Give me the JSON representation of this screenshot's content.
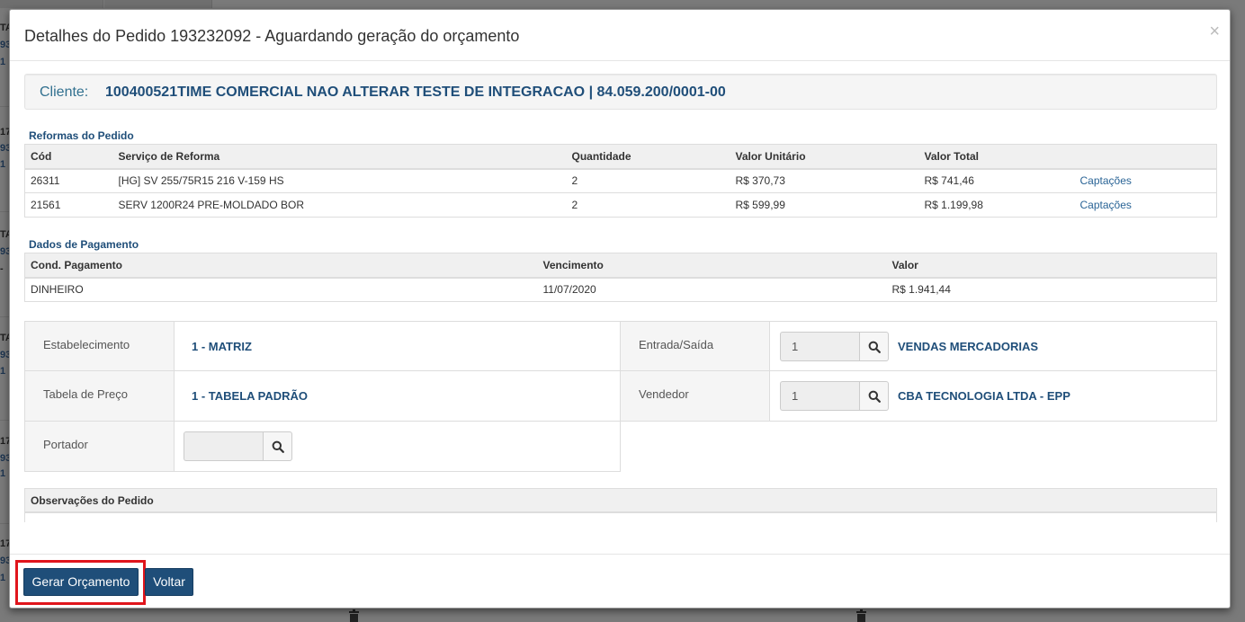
{
  "modal": {
    "title": "Detalhes do Pedido 193232092 - Aguardando geração do orçamento",
    "close_label": "×"
  },
  "client": {
    "label": "Cliente:",
    "value": "100400521TIME COMERCIAL NAO ALTERAR TESTE DE INTEGRACAO | 84.059.200/0001-00"
  },
  "reformas": {
    "title": "Reformas do Pedido",
    "headers": [
      "Cód",
      "Serviço de Reforma",
      "Quantidade",
      "Valor Unitário",
      "Valor Total",
      ""
    ],
    "rows": [
      {
        "cod": "26311",
        "servico": "[HG] SV 255/75R15 216 V-159 HS",
        "quantidade": "2",
        "unitario": "R$ 370,73",
        "total": "R$ 741,46",
        "acao": "Captações"
      },
      {
        "cod": "21561",
        "servico": "SERV 1200R24 PRE-MOLDADO BOR",
        "quantidade": "2",
        "unitario": "R$ 599,99",
        "total": "R$ 1.199,98",
        "acao": "Captações"
      }
    ]
  },
  "pagamento": {
    "title": "Dados de Pagamento",
    "headers": [
      "Cond. Pagamento",
      "Vencimento",
      "Valor"
    ],
    "rows": [
      {
        "cond": "DINHEIRO",
        "vencimento": "11/07/2020",
        "valor": "R$ 1.941,44"
      }
    ]
  },
  "form": {
    "estabelecimento_label": "Estabelecimento",
    "estabelecimento_value": "1 - MATRIZ",
    "tabela_label": "Tabela de Preço",
    "tabela_value": "1 - TABELA PADRÃO",
    "portador_label": "Portador",
    "portador_value": "",
    "entrada_label": "Entrada/Saída",
    "entrada_code": "1",
    "entrada_desc": "VENDAS MERCADORIAS",
    "vendedor_label": "Vendedor",
    "vendedor_code": "1",
    "vendedor_desc": "CBA TECNOLOGIA LTDA - EPP"
  },
  "observacoes": {
    "title": "Observações do Pedido"
  },
  "footer": {
    "gerar_label": "Gerar Orçamento",
    "voltar_label": "Voltar"
  },
  "background": {
    "fragments": [
      "TA",
      "93",
      "1",
      "17",
      "93",
      "1",
      "TA",
      "93",
      "-",
      "TA",
      "93",
      "1",
      "17",
      "93",
      "1",
      "17",
      "93",
      "1"
    ]
  },
  "colors": {
    "primary": "#1f4e79",
    "highlight": "#e0151c",
    "link": "#2a6496"
  },
  "icons": {
    "search": "search-icon",
    "close": "close-icon",
    "trash": "trash-icon"
  }
}
